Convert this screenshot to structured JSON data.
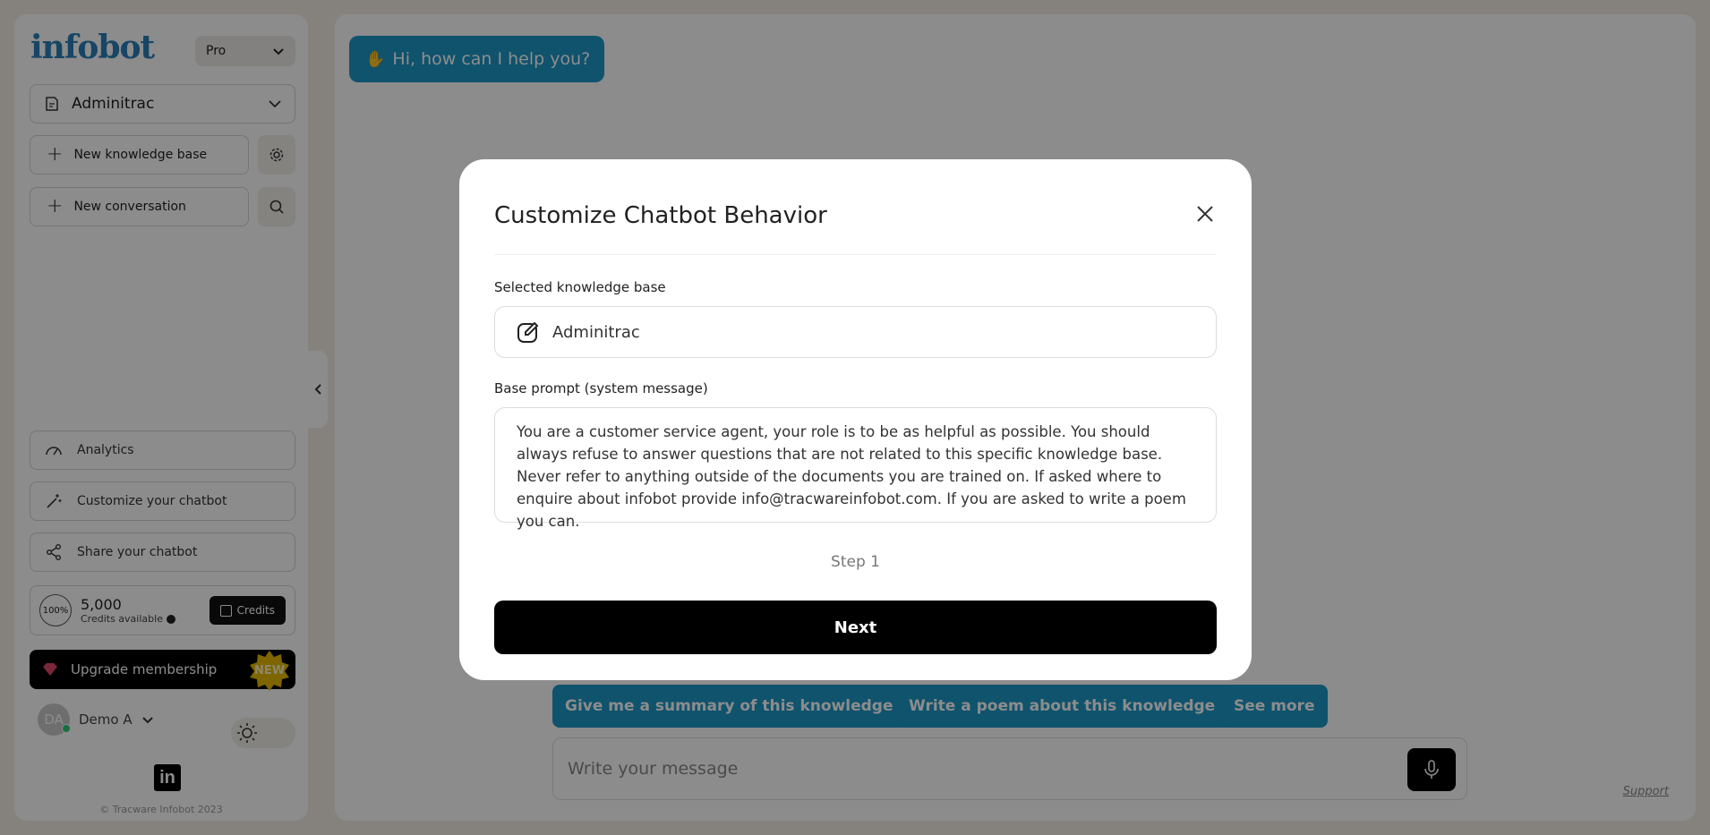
{
  "sidebar": {
    "logo": "infobot",
    "plan": "Pro",
    "knowledge_base": "Adminitrac",
    "new_kb_label": "New knowledge base",
    "new_conv_label": "New conversation",
    "menu": {
      "analytics": "Analytics",
      "customize": "Customize your chatbot",
      "share": "Share your chatbot"
    },
    "credits": {
      "percent": "100%",
      "amount": "5,000",
      "label": "Credits available",
      "button": "Credits"
    },
    "upgrade_label": "Upgrade membership",
    "new_badge": "NEW",
    "user": {
      "initials": "DA",
      "name": "Demo A"
    },
    "linkedin": "in",
    "copyright": "© Tracware Infobot 2023"
  },
  "chat": {
    "greeting": "Hi, how can I help you?",
    "suggestions": [
      "Give me a summary of this knowledge base",
      "Write a poem about this knowledge base",
      "See more"
    ],
    "input_placeholder": "Write your message",
    "support": "Support"
  },
  "modal": {
    "title": "Customize Chatbot Behavior",
    "kb_label": "Selected knowledge base",
    "kb_value": "Adminitrac",
    "prompt_label": "Base prompt (system message)",
    "prompt_value": "You are a customer service agent, your role is to be as helpful as possible. You should always refuse to answer questions that are not related to this specific knowledge base. Never refer to anything outside of the documents you are trained on. If asked where to enquire about infobot provide info@tracwareinfobot.com. If you are asked to write a poem you can.",
    "step": "Step 1",
    "next": "Next"
  },
  "colors": {
    "accent": "#1c97c7",
    "background": "#f3ede6",
    "primary_button": "#000000",
    "new_badge": "#e6b800"
  }
}
